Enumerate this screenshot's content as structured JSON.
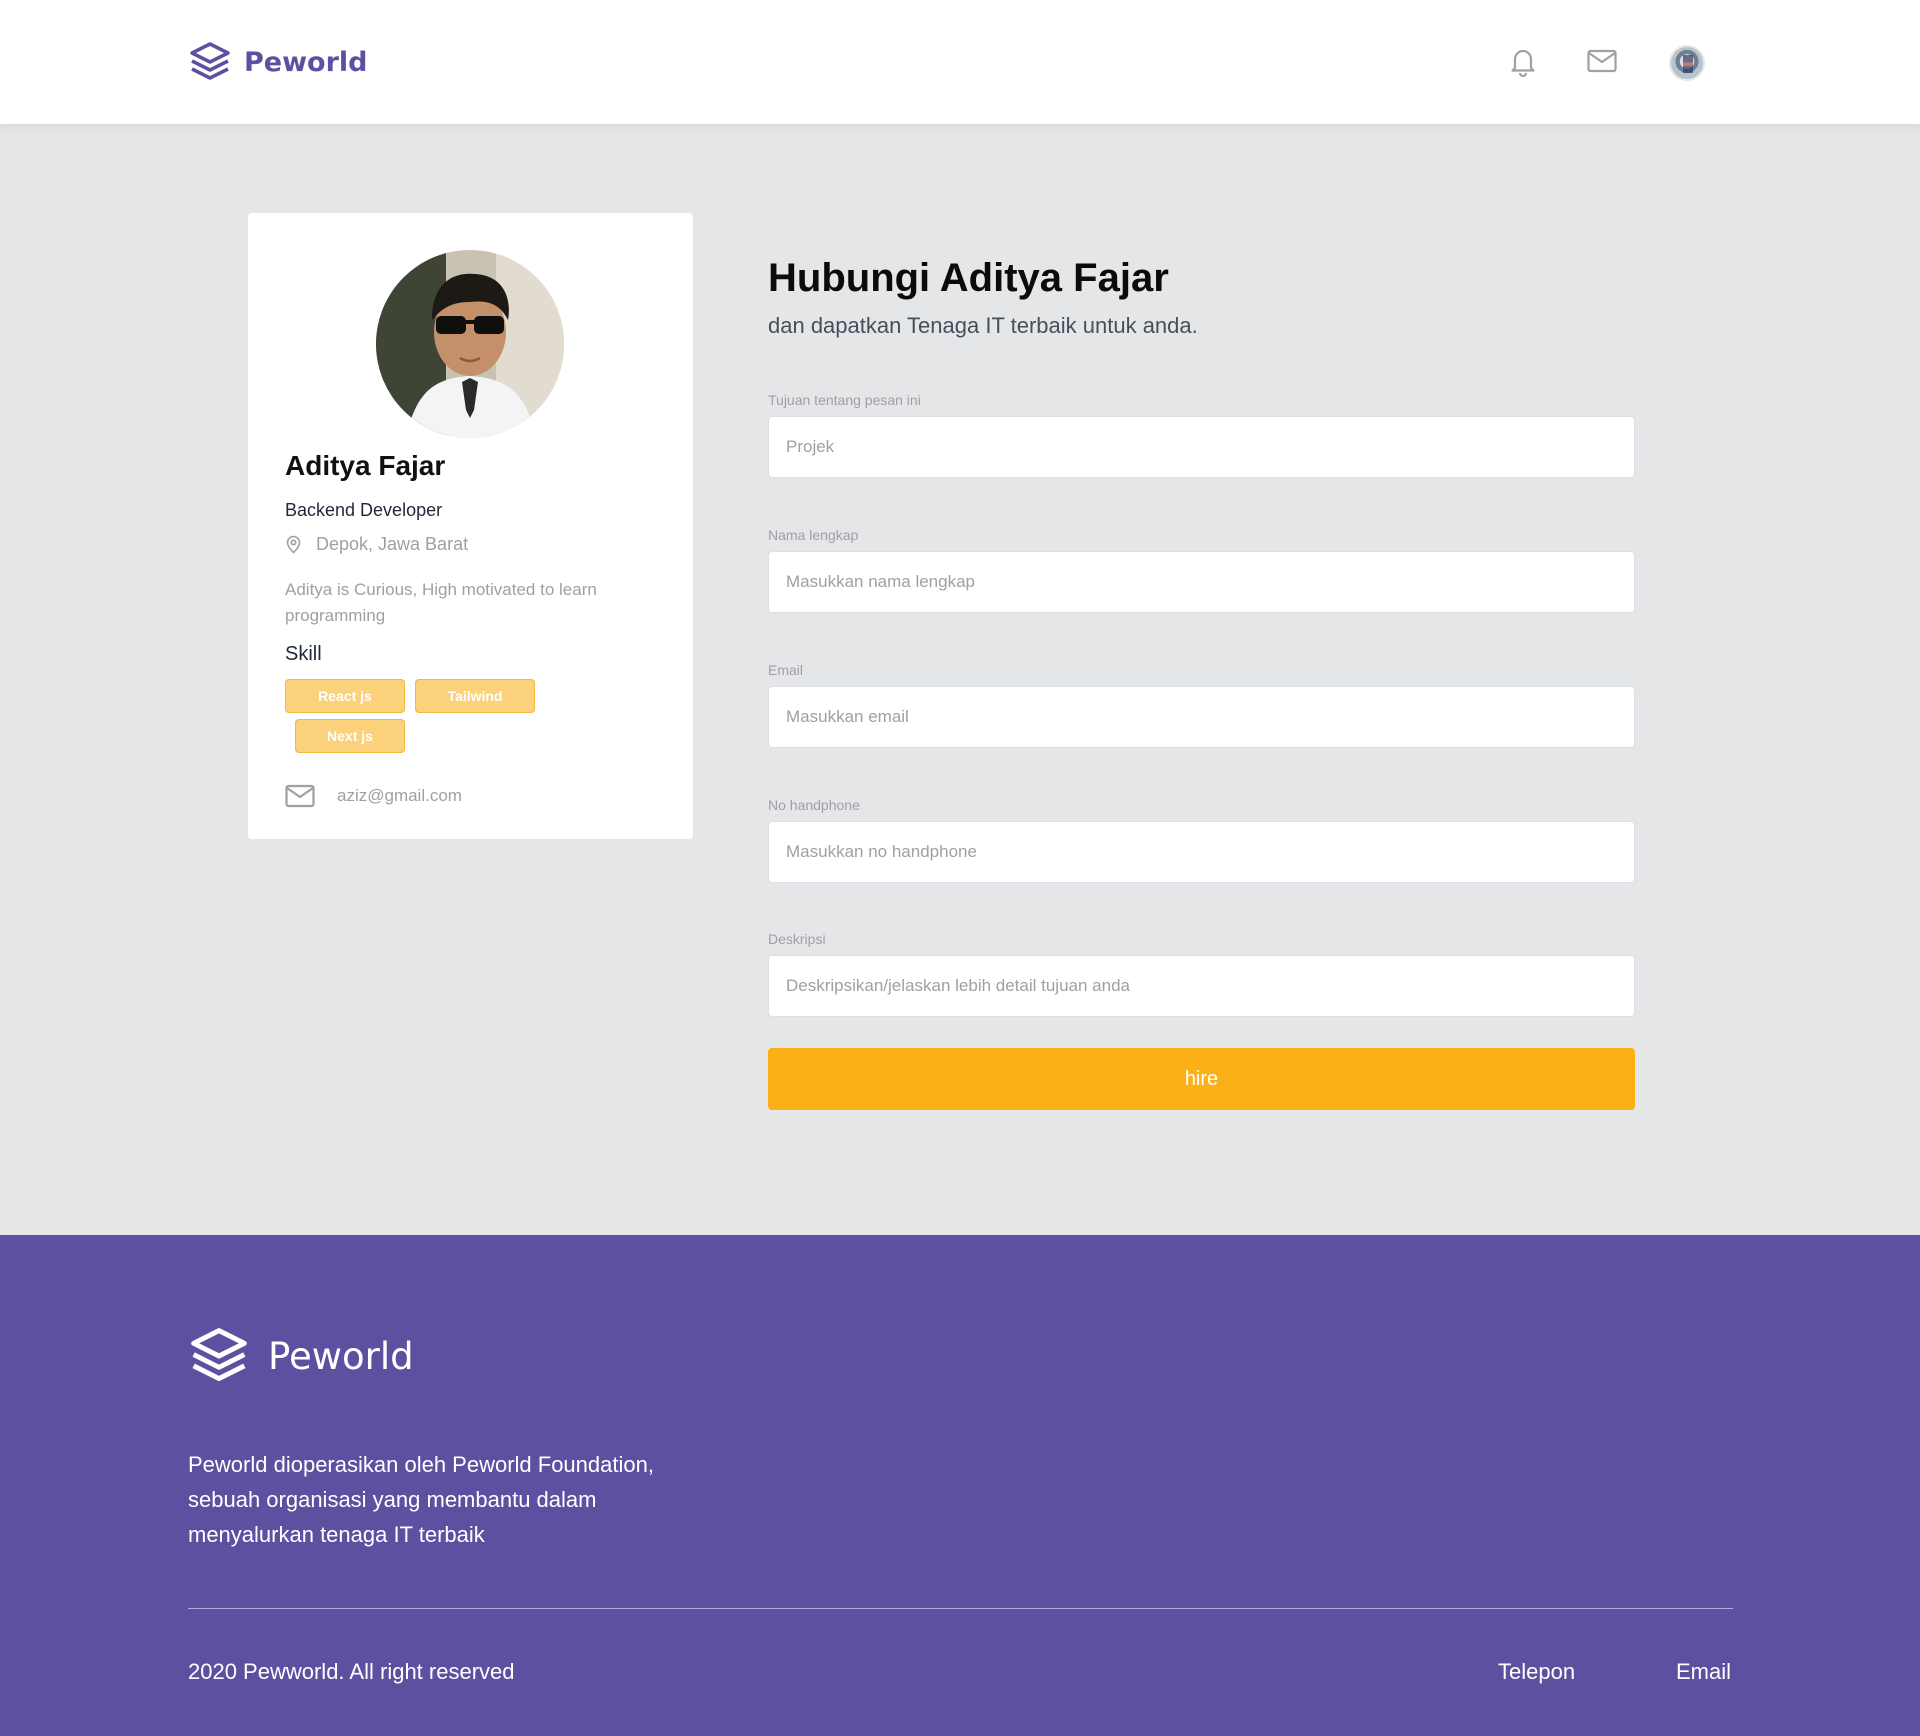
{
  "header": {
    "brand": "Peworld"
  },
  "profile": {
    "name": "Aditya Fajar",
    "role": "Backend Developer",
    "location": "Depok, Jawa Barat",
    "description": "Aditya is Curious, High motivated to learn programming",
    "skill_heading": "Skill",
    "skills": [
      "React js",
      "Tailwind",
      "Next js"
    ],
    "email": "aziz@gmail.com"
  },
  "form": {
    "title": "Hubungi Aditya Fajar",
    "subtitle": "dan dapatkan Tenaga IT terbaik untuk anda.",
    "fields": [
      {
        "label": "Tujuan tentang pesan ini",
        "placeholder": "Projek"
      },
      {
        "label": "Nama lengkap",
        "placeholder": "Masukkan nama lengkap"
      },
      {
        "label": "Email",
        "placeholder": "Masukkan email"
      },
      {
        "label": "No handphone",
        "placeholder": "Masukkan no handphone"
      },
      {
        "label": "Deskripsi",
        "placeholder": "Deskripsikan/jelaskan lebih detail tujuan anda"
      }
    ],
    "submit_label": "hire"
  },
  "footer": {
    "brand": "Peworld",
    "description": "Peworld dioperasikan oleh Peworld Foundation, sebuah organisasi yang membantu dalam menyalurkan tenaga IT terbaik",
    "copyright": "2020 Pewworld. All right reserved",
    "links": [
      "Telepon",
      "Email"
    ]
  },
  "colors": {
    "brand": "#5e50a1",
    "accent": "#fbb017",
    "skill_chip": "#fbd17b",
    "background": "#e5e6e8"
  },
  "icons": {
    "logo": "layers-stack-icon",
    "notification": "bell-icon",
    "mail": "mail-icon",
    "location": "map-pin-icon"
  }
}
